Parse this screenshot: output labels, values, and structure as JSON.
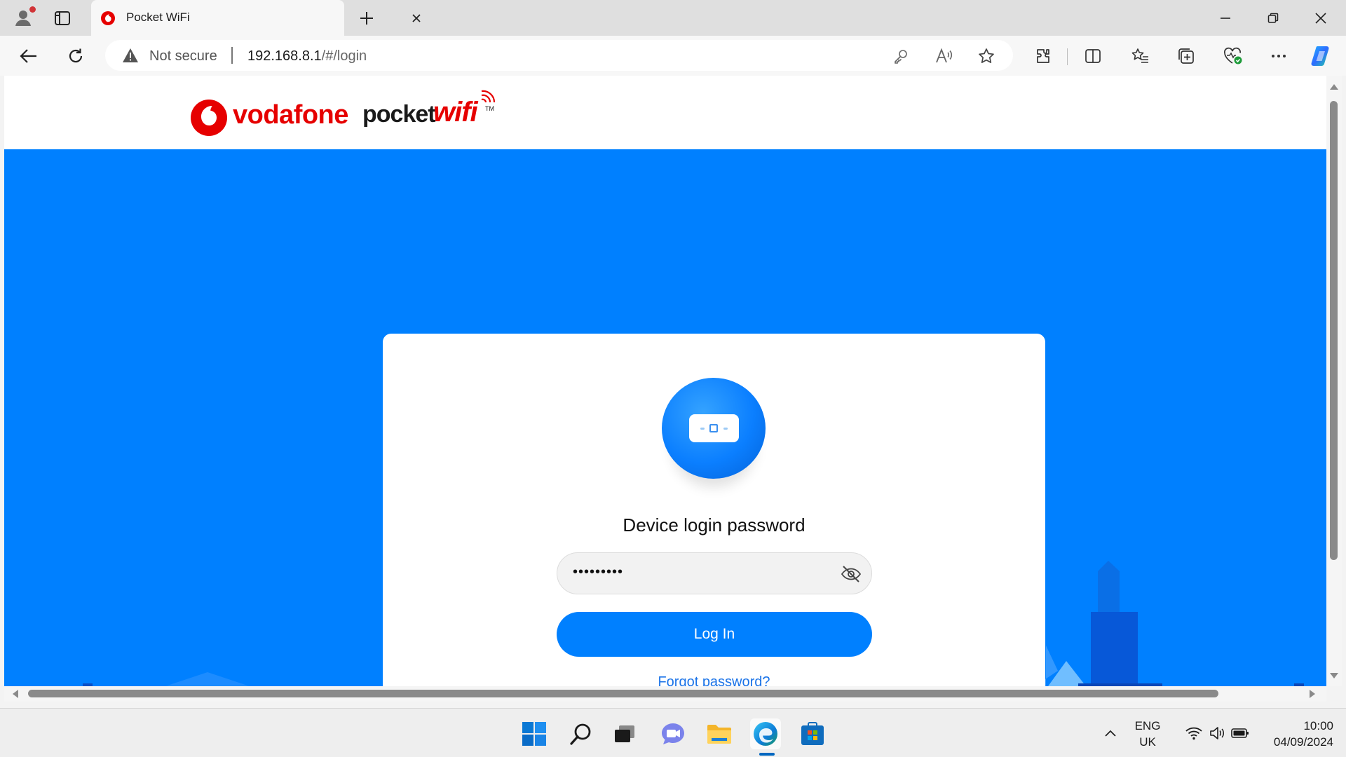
{
  "browser": {
    "tab": {
      "title": "Pocket WiFi"
    },
    "address": {
      "security_label": "Not secure",
      "url_host": "192.168.8.1",
      "url_path": "/#/login"
    }
  },
  "site": {
    "brand_name": "vodafone",
    "product_word1": "pocket",
    "product_word2": "wifi",
    "product_tm": "TM"
  },
  "login": {
    "title": "Device login password",
    "password_masked": "•••••••••",
    "login_button": "Log In",
    "forgot_link": "Forgot password?"
  },
  "taskbar": {
    "language_line1": "ENG",
    "language_line2": "UK",
    "time": "10:00",
    "date": "04/09/2024"
  },
  "colors": {
    "brand_red": "#e60000",
    "hero_blue": "#0080ff",
    "button_blue": "#0080ff",
    "link_blue": "#1a73e8"
  }
}
